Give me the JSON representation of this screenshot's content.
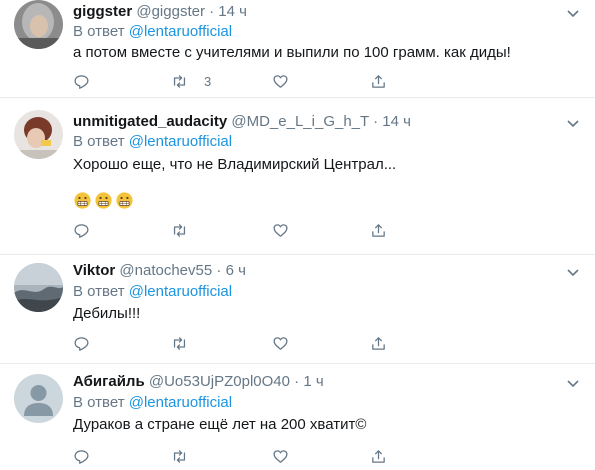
{
  "reply_prefix": "В ответ",
  "colors": {
    "accent": "#1b95e0",
    "muted": "#657786",
    "divider": "#e6ecf0",
    "emoji": "#f5c33b"
  },
  "tweets": [
    {
      "name": "giggster",
      "handle": "@giggster",
      "dot": "·",
      "time": "14 ч",
      "reply_to": "@lentaruofficial",
      "text": "а потом вместе с учителями и выпили по 100 грамм. как диды!",
      "reply_count": "",
      "retweet_count": "3",
      "like_count": ""
    },
    {
      "name": "unmitigated_audacity",
      "handle": "@MD_e_L_i_G_h_T",
      "dot": "·",
      "time": "14 ч",
      "reply_to": "@lentaruofficial",
      "text": "Хорошо еще, что не Владимирский Централ...",
      "emoji": [
        "grimacing-face-emoji",
        "grimacing-face-emoji",
        "grimacing-face-emoji"
      ],
      "reply_count": "",
      "retweet_count": "",
      "like_count": ""
    },
    {
      "name": "Viktor",
      "handle": "@natochev55",
      "dot": "·",
      "time": "6 ч",
      "reply_to": "@lentaruofficial",
      "text": "Дебилы!!!",
      "reply_count": "",
      "retweet_count": "",
      "like_count": ""
    },
    {
      "name": "Абигайль",
      "handle": "@Uo53UjPZ0pl0O40",
      "dot": "·",
      "time": "1 ч",
      "reply_to": "@lentaruofficial",
      "text": "Дураков а стране ещё лет на 200 хватит©",
      "reply_count": "",
      "retweet_count": "",
      "like_count": ""
    }
  ]
}
